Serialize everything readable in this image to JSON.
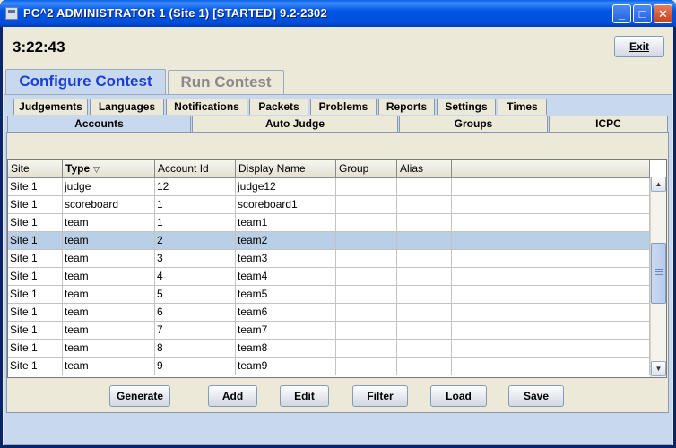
{
  "window": {
    "title": "PC^2 ADMINISTRATOR 1 (Site 1) [STARTED] 9.2-2302",
    "min_glyph": "_",
    "max_glyph": "□",
    "close_glyph": "✕"
  },
  "header": {
    "clock": "3:22:43",
    "exit_label": "Exit"
  },
  "main_tabs": [
    {
      "label": "Configure Contest",
      "active": true
    },
    {
      "label": "Run Contest",
      "active": false
    }
  ],
  "sub_tabs_row1": [
    {
      "label": "Judgements"
    },
    {
      "label": "Languages"
    },
    {
      "label": "Notifications"
    },
    {
      "label": "Packets"
    },
    {
      "label": "Problems"
    },
    {
      "label": "Reports"
    },
    {
      "label": "Settings"
    },
    {
      "label": "Times"
    }
  ],
  "sub_tabs_row2": [
    {
      "label": "Accounts",
      "active": true
    },
    {
      "label": "Auto Judge"
    },
    {
      "label": "Groups"
    },
    {
      "label": "ICPC"
    }
  ],
  "table": {
    "columns": [
      "Site",
      "Type",
      "Account Id",
      "Display Name",
      "Group",
      "Alias"
    ],
    "sorted_column": "Type",
    "sort_indicator": "▽",
    "rows": [
      {
        "site": "Site 1",
        "type": "judge",
        "account_id": "12",
        "display_name": "judge12",
        "group": "",
        "alias": ""
      },
      {
        "site": "Site 1",
        "type": "scoreboard",
        "account_id": "1",
        "display_name": "scoreboard1",
        "group": "",
        "alias": ""
      },
      {
        "site": "Site 1",
        "type": "team",
        "account_id": "1",
        "display_name": "team1",
        "group": "",
        "alias": ""
      },
      {
        "site": "Site 1",
        "type": "team",
        "account_id": "2",
        "display_name": "team2",
        "group": "",
        "alias": "",
        "selected": true
      },
      {
        "site": "Site 1",
        "type": "team",
        "account_id": "3",
        "display_name": "team3",
        "group": "",
        "alias": ""
      },
      {
        "site": "Site 1",
        "type": "team",
        "account_id": "4",
        "display_name": "team4",
        "group": "",
        "alias": ""
      },
      {
        "site": "Site 1",
        "type": "team",
        "account_id": "5",
        "display_name": "team5",
        "group": "",
        "alias": ""
      },
      {
        "site": "Site 1",
        "type": "team",
        "account_id": "6",
        "display_name": "team6",
        "group": "",
        "alias": ""
      },
      {
        "site": "Site 1",
        "type": "team",
        "account_id": "7",
        "display_name": "team7",
        "group": "",
        "alias": ""
      },
      {
        "site": "Site 1",
        "type": "team",
        "account_id": "8",
        "display_name": "team8",
        "group": "",
        "alias": ""
      },
      {
        "site": "Site 1",
        "type": "team",
        "account_id": "9",
        "display_name": "team9",
        "group": "",
        "alias": ""
      }
    ],
    "scroll_up_glyph": "▲",
    "scroll_down_glyph": "▼"
  },
  "actions": [
    {
      "label": "Generate"
    },
    {
      "label": "Add"
    },
    {
      "label": "Edit"
    },
    {
      "label": "Filter"
    },
    {
      "label": "Load"
    },
    {
      "label": "Save"
    }
  ],
  "colors": {
    "titlebar": "#0055e5",
    "active_tab_text": "#1a3fd6",
    "selected_row": "#b8cfe5",
    "panel_blue": "#c9d9ed"
  }
}
